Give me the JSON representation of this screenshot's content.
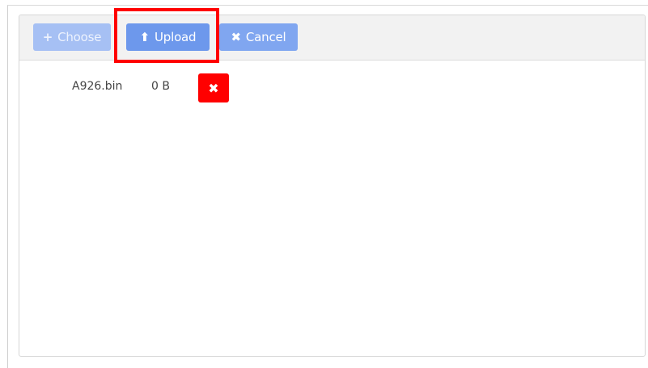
{
  "toolbar": {
    "choose": {
      "icon": "plus-icon",
      "glyph": "+",
      "label": "Choose"
    },
    "upload": {
      "icon": "upload-icon",
      "glyph": "⬆",
      "label": "Upload"
    },
    "cancel": {
      "icon": "times-icon",
      "glyph": "✖",
      "label": "Cancel"
    }
  },
  "files": [
    {
      "name": "A926.bin",
      "size": "0 B",
      "remove_icon": "times-icon",
      "remove_glyph": "✖"
    }
  ],
  "colors": {
    "choose_disabled": "#a6c0f4",
    "upload": "#6d98ec",
    "cancel": "#80a6f0",
    "remove": "#ff0000",
    "highlight": "#ff0000"
  }
}
